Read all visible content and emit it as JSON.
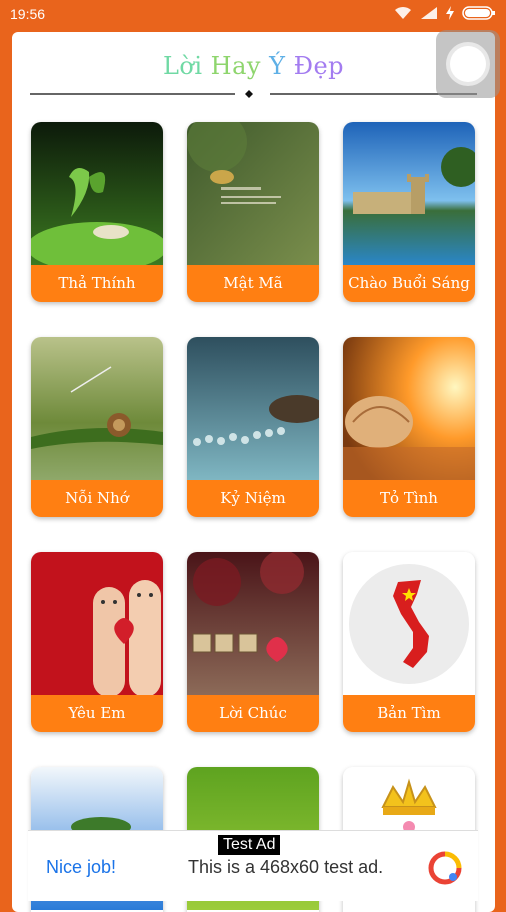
{
  "status_bar": {
    "time": "19:56",
    "icons": [
      "wifi-icon",
      "signal-icon",
      "charging-icon",
      "battery-icon"
    ]
  },
  "header": {
    "title_words": [
      "Lời",
      "Hay",
      "Ý",
      "Đẹp"
    ]
  },
  "categories": [
    {
      "label": "Thả Thính"
    },
    {
      "label": "Mật Mã"
    },
    {
      "label": "Chào Buổi Sáng"
    },
    {
      "label": "Nỗi Nhớ"
    },
    {
      "label": "Kỷ Niệm"
    },
    {
      "label": "Tỏ Tình"
    },
    {
      "label": "Yêu Em"
    },
    {
      "label": "Lời Chúc"
    },
    {
      "label": "Bản Tìm"
    }
  ],
  "ad": {
    "tag": "Test Ad",
    "cta": "Nice job!",
    "message": "This is a 468x60 test ad."
  },
  "colors": {
    "brand_orange": "#E9641C",
    "tile_label_orange": "#FF7F12"
  }
}
